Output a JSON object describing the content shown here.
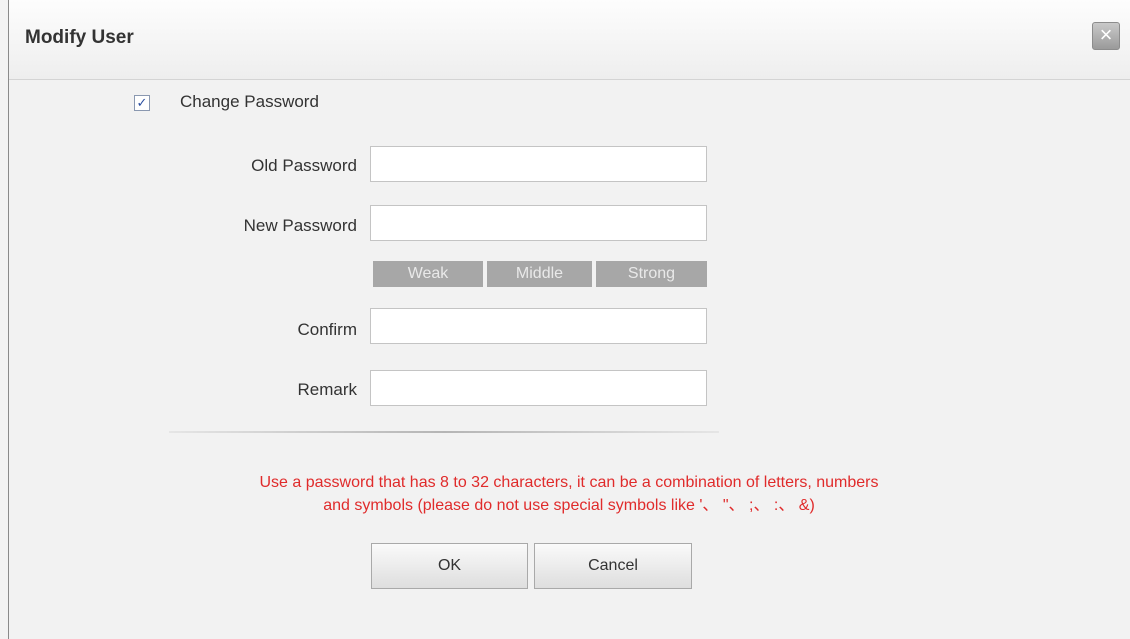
{
  "dialog": {
    "title": "Modify User",
    "close_symbol": "×"
  },
  "change_password": {
    "checked": true,
    "check_symbol": "✓",
    "label": "Change Password"
  },
  "fields": {
    "old_password": {
      "label": "Old Password",
      "value": ""
    },
    "new_password": {
      "label": "New Password",
      "value": ""
    },
    "confirm": {
      "label": "Confirm",
      "value": ""
    },
    "remark": {
      "label": "Remark",
      "value": ""
    }
  },
  "strength": {
    "weak": "Weak",
    "middle": "Middle",
    "strong": "Strong",
    "indicator_color": "#a7a7a7"
  },
  "hint": {
    "line1": "Use a password that has 8 to 32 characters, it can be a combination of letters, numbers",
    "line2": "and symbols (please do not use special symbols like '、 \"、 ;、 :、 &)",
    "color": "#e02b2b"
  },
  "buttons": {
    "ok": "OK",
    "cancel": "Cancel"
  },
  "icons": {
    "close": "close-icon",
    "checkbox": "checkmark-icon"
  }
}
